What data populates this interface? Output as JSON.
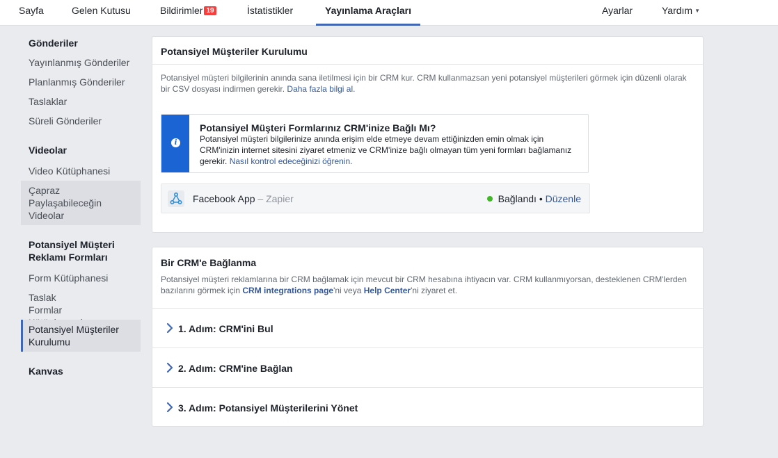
{
  "nav": {
    "tabs": [
      {
        "label": "Sayfa"
      },
      {
        "label": "Gelen Kutusu"
      },
      {
        "label": "Bildirimler",
        "badge": "19"
      },
      {
        "label": "İstatistikler"
      },
      {
        "label": "Yayınlama Araçları",
        "active": true
      }
    ],
    "settings": "Ayarlar",
    "help": "Yardım"
  },
  "sidebar": {
    "sections": [
      {
        "title": "Gönderiler",
        "items": [
          "Yayınlanmış Gönderiler",
          "Planlanmış Gönderiler",
          "Taslaklar",
          "Süreli Gönderiler"
        ]
      },
      {
        "title": "Videolar",
        "items": [
          "Video Kütüphanesi",
          "Çapraz Paylaşabileceğin Videolar"
        ]
      },
      {
        "title": "Potansiyel Müşteri Reklamı Formları",
        "items": [
          "Form Kütüphanesi",
          "Taslak Formlar Kütüphanesi",
          "Potansiyel Müşteriler Kurulumu"
        ]
      },
      {
        "title": "Kanvas",
        "items": []
      }
    ],
    "active_item": "Potansiyel Müşteriler Kurulumu"
  },
  "setup_card": {
    "title": "Potansiyel Müşteriler Kurulumu",
    "description": "Potansiyel müşteri bilgilerinin anında sana iletilmesi için bir CRM kur. CRM kullanmazsan yeni potansiyel müşterileri görmek için düzenli olarak bir CSV dosyası indirmen gerekir.",
    "learn_more": "Daha fazla bilgi al.",
    "info": {
      "title": "Potansiyel Müşteri Formlarınız CRM'inize Bağlı Mı?",
      "text": "Potansiyel müşteri bilgilerinize anında erişim elde etmeye devam ettiğinizden emin olmak için CRM'inizin internet sitesini ziyaret etmeniz ve CRM'inize bağlı olmayan tüm yeni formları bağlamanız gerekir.",
      "link": "Nasıl kontrol edeceğinizi öğrenin."
    },
    "connection": {
      "name": "Facebook App",
      "provider": "Zapier",
      "status": "Bağlandı",
      "status_color": "#42b72a",
      "edit": "Düzenle"
    }
  },
  "crm_card": {
    "title": "Bir CRM'e Bağlanma",
    "desc_part1": "Potansiyel müşteri reklamlarına bir CRM bağlamak için mevcut bir CRM hesabına ihtiyacın var. CRM kullanmıyorsan, desteklenen CRM'lerden bazılarını görmek için ",
    "link1": "CRM integrations page",
    "desc_part2": "'ni veya ",
    "link2": "Help Center",
    "desc_part3": "'ni ziyaret et.",
    "steps": [
      "1. Adım: CRM'ini Bul",
      "2. Adım: CRM'ine Bağlan",
      "3. Adım: Potansiyel Müşterilerini Yönet"
    ]
  },
  "colors": {
    "accent": "#4267b2",
    "info_bar": "#1b64d4",
    "badge": "#fa3e3e",
    "link": "#365899"
  }
}
